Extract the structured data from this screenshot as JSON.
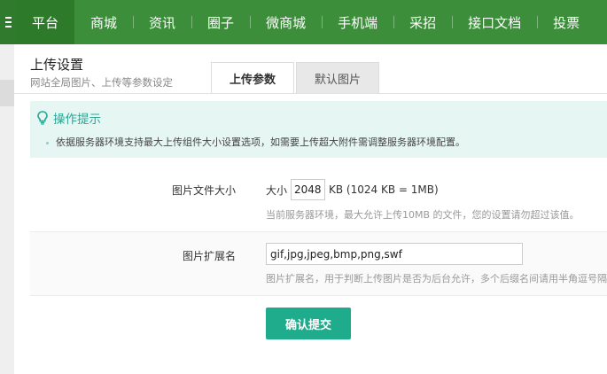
{
  "nav": {
    "items": [
      {
        "label": "平台",
        "active": true
      },
      {
        "label": "商城"
      },
      {
        "label": "资讯"
      },
      {
        "label": "圈子"
      },
      {
        "label": "微商城"
      },
      {
        "label": "手机端"
      },
      {
        "label": "采招"
      },
      {
        "label": "接口文档"
      },
      {
        "label": "投票"
      }
    ],
    "color": "#3d8e3b"
  },
  "page": {
    "title": "上传设置",
    "subtitle": "网站全局图片、上传等参数设定"
  },
  "tabs": [
    {
      "label": "上传参数",
      "active": true
    },
    {
      "label": "默认图片"
    }
  ],
  "tips": {
    "title": "操作提示",
    "items": [
      "依据服务器环境支持最大上传组件大小设置选项，如需要上传超大附件需调整服务器环境配置。"
    ]
  },
  "form": {
    "file_size": {
      "label": "图片文件大小",
      "prefix": "大小",
      "value": "2048",
      "suffix": "KB (1024 KB = 1MB)",
      "hint": "当前服务器环境，最大允许上传10MB 的文件，您的设置请勿超过该值。"
    },
    "extensions": {
      "label": "图片扩展名",
      "value": "gif,jpg,jpeg,bmp,png,swf",
      "hint": "图片扩展名，用于判断上传图片是否为后台允许，多个后缀名间请用半角逗号隔开"
    },
    "submit_label": "确认提交"
  }
}
